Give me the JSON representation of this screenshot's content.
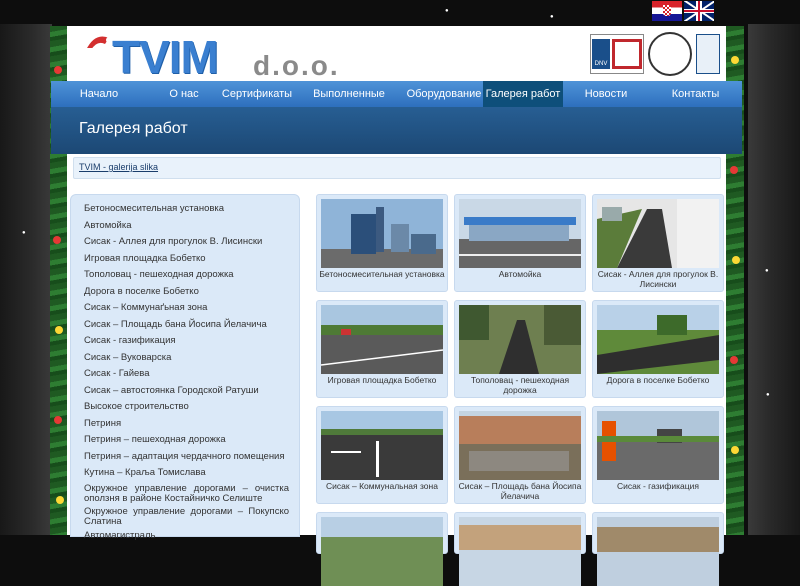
{
  "flags": [
    {
      "lang": "hr",
      "icon": "croatia-flag-icon"
    },
    {
      "lang": "en",
      "icon": "uk-flag-icon"
    }
  ],
  "header": {
    "logo": "TVIM",
    "logo_suffix": "d.o.o.",
    "cert_labels": [
      "DNV",
      "DNV",
      "DNV"
    ]
  },
  "nav": {
    "items": [
      {
        "label": "Начало",
        "active": false
      },
      {
        "label": "О нас",
        "active": false
      },
      {
        "label": "Сертификаты",
        "active": false
      },
      {
        "label": "Выполненные проекты",
        "active": false
      },
      {
        "label": "Оборудование",
        "active": false
      },
      {
        "label": "Галерея работ",
        "active": true
      },
      {
        "label": "Новости",
        "active": false
      },
      {
        "label": "Контакты",
        "active": false
      }
    ]
  },
  "banner": {
    "title": "Галерея работ"
  },
  "breadcrumb": {
    "link": "TVIM - galerija slika"
  },
  "sidebar": {
    "items": [
      "Бетоносмесительная установка",
      "Автомойка",
      "Сисак - Аллея для прогулок В. Лисински",
      "Игровая площадка Бобетко",
      "Тополовац - пешеходная дорожка",
      "Дорога в поселке Бобетко",
      "Сисак – Коммунаґьная зона",
      "Сисак – Площадь бана Йосипа Йелачича",
      "Сисак - газификация",
      "Сисак – Вуковарска",
      "Сисак - Гайева",
      "Сисак – автостоянка Городской Ратуши",
      "Высокое строительство",
      "Петриня",
      "Петриня – пешеходная дорожка",
      "Петриня – адаптация чердачного помещения",
      "Кутина – Краља Томислава",
      "Окружное управление дорогами – очистка оползня в районе Костайничко Селиште",
      "Окружное управление дорогами – Покупско Слатина",
      "Автомагистраль"
    ]
  },
  "gallery": {
    "items": [
      "Бетоносмесительная установка",
      "Автомойка",
      "Сисак - Аллея для прогулок В. Лисински",
      "Игровая площадка Бобетко",
      "Тополовац - пешеходная дорожка",
      "Дорога в поселке Бобетко",
      "Сисак – Коммунальная зона",
      "Сисак – Площадь бана Йосипа Йелачича",
      "Сисак - газификация",
      "",
      "",
      ""
    ]
  }
}
